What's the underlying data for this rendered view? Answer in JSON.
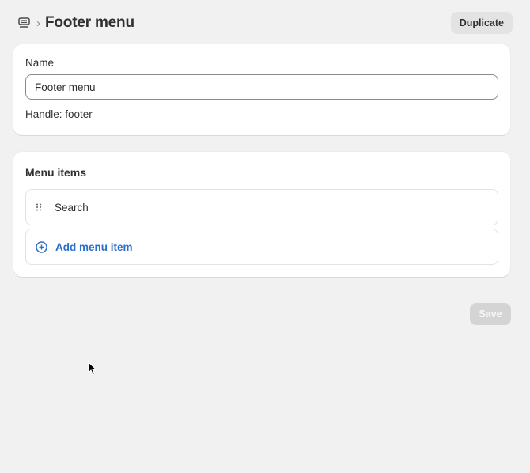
{
  "header": {
    "nav_icon": "navigation-menu-icon",
    "separator": "›",
    "title": "Footer menu",
    "duplicate_label": "Duplicate"
  },
  "name_card": {
    "name_label": "Name",
    "name_value": "Footer menu",
    "handle_text": "Handle: footer"
  },
  "menu_card": {
    "title": "Menu items",
    "items": [
      {
        "label": "Search",
        "icon": "drag-handle-icon"
      }
    ],
    "add_label": "Add menu item",
    "add_icon": "plus-circle-icon",
    "accent_color": "#2c6ecb"
  },
  "actions": {
    "save_label": "Save",
    "save_state": "disabled"
  }
}
